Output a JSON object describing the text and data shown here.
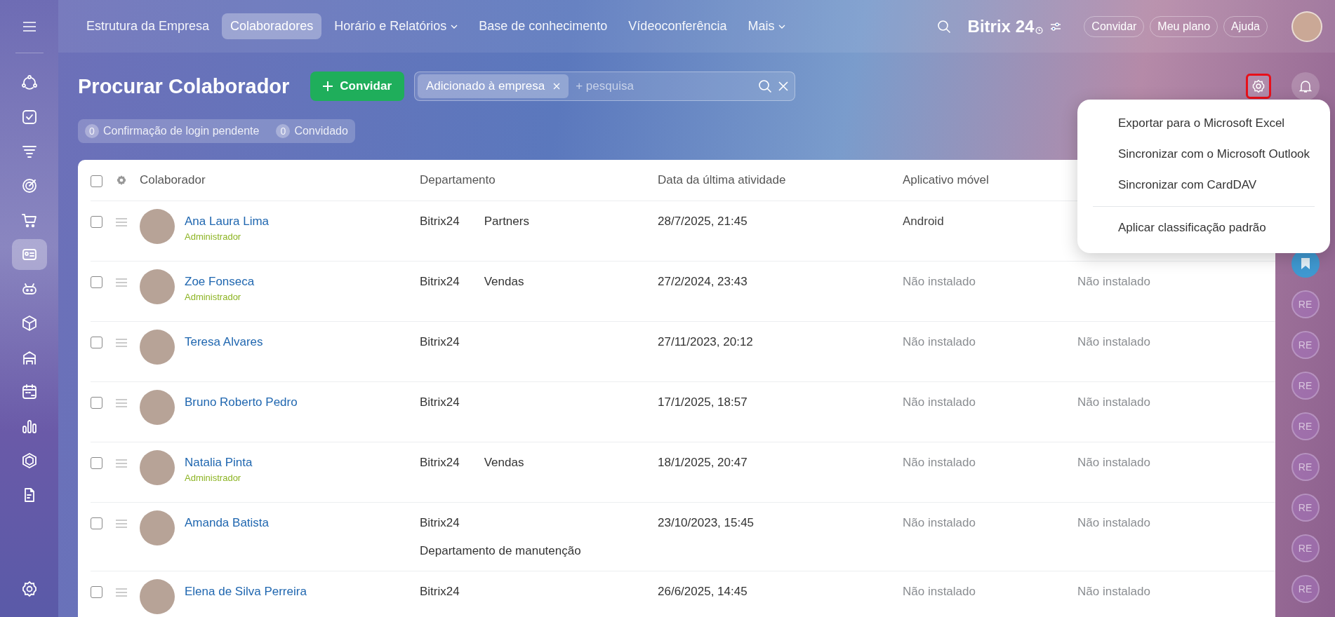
{
  "top_nav": {
    "items": [
      {
        "label": "Estrutura da Empresa",
        "selected": false,
        "dropdown": false
      },
      {
        "label": "Colaboradores",
        "selected": true,
        "dropdown": false
      },
      {
        "label": "Horário e Relatórios",
        "selected": false,
        "dropdown": true
      },
      {
        "label": "Base de conhecimento",
        "selected": false,
        "dropdown": false
      },
      {
        "label": "Vídeoconferência",
        "selected": false,
        "dropdown": false
      },
      {
        "label": "Mais",
        "selected": false,
        "dropdown": true
      }
    ],
    "logo": {
      "name": "Bitrix",
      "number": "24"
    },
    "buttons": [
      "Convidar",
      "Meu plano",
      "Ajuda"
    ]
  },
  "sidebar": {
    "items": [
      {
        "kind": "network",
        "selected": false
      },
      {
        "kind": "tasks",
        "selected": false
      },
      {
        "kind": "funnel",
        "selected": false
      },
      {
        "kind": "target",
        "selected": false
      },
      {
        "kind": "cart",
        "selected": false
      },
      {
        "kind": "contacts",
        "selected": true
      },
      {
        "kind": "robot",
        "selected": false
      },
      {
        "kind": "box",
        "selected": false
      },
      {
        "kind": "store",
        "selected": false
      },
      {
        "kind": "calendar",
        "selected": false
      },
      {
        "kind": "chart",
        "selected": false
      },
      {
        "kind": "hexagon",
        "selected": false
      },
      {
        "kind": "document",
        "selected": false
      }
    ]
  },
  "page": {
    "title": "Procurar Colaborador",
    "invite_button": "Convidar",
    "search": {
      "tag": "Adicionado à empresa",
      "placeholder": "+ pesquisa"
    },
    "settings_highlighted": true,
    "counters": [
      {
        "count": "0",
        "label": "Confirmação de login pendente"
      },
      {
        "count": "0",
        "label": "Convidado"
      }
    ]
  },
  "table": {
    "select_all": false,
    "columns": [
      "Colaborador",
      "Departamento",
      "Data da última atividade",
      "Aplicativo móvel"
    ],
    "rows": [
      {
        "name": "Ana Laura Lima",
        "role": "Administrador",
        "selected": false,
        "departments": [
          "Bitrix24",
          "Partners"
        ],
        "last_activity": "28/7/2025, 21:45",
        "mobile_app": "Android",
        "app_installed": true
      },
      {
        "name": "Zoe Fonseca",
        "role": "Administrador",
        "selected": false,
        "departments": [
          "Bitrix24",
          "Vendas"
        ],
        "last_activity": "27/2/2024, 23:43",
        "mobile_app": "Não instalado",
        "app_installed": false,
        "column_5": "Não instalado"
      },
      {
        "name": "Teresa Alvares",
        "selected": false,
        "departments": [
          "Bitrix24"
        ],
        "last_activity": "27/11/2023, 20:12",
        "mobile_app": "Não instalado",
        "app_installed": false,
        "column_5": "Não instalado"
      },
      {
        "name": "Bruno Roberto Pedro",
        "selected": false,
        "departments": [
          "Bitrix24"
        ],
        "last_activity": "17/1/2025, 18:57",
        "mobile_app": "Não instalado",
        "app_installed": false,
        "column_5": "Não instalado"
      },
      {
        "name": "Natalia Pinta",
        "role": "Administrador",
        "selected": false,
        "departments": [
          "Bitrix24",
          "Vendas"
        ],
        "last_activity": "18/1/2025, 20:47",
        "mobile_app": "Não instalado",
        "app_installed": false,
        "column_5": "Não instalado"
      },
      {
        "name": "Amanda Batista",
        "selected": false,
        "departments": [
          "Bitrix24",
          "Departamento de manutenção"
        ],
        "last_activity": "23/10/2023, 15:45",
        "mobile_app": "Não instalado",
        "app_installed": false,
        "column_5": "Não instalado"
      },
      {
        "name": "Elena de Silva Perreira",
        "selected": false,
        "departments": [
          "Bitrix24"
        ],
        "last_activity": "26/6/2025, 14:45",
        "mobile_app": "Não instalado",
        "app_installed": false,
        "column_5": "Não instalado"
      }
    ]
  },
  "settings_menu": {
    "items": [
      {
        "label": "Exportar para o Microsoft Excel",
        "separator_before": false
      },
      {
        "label": "Sincronizar com o Microsoft Outlook",
        "separator_before": false
      },
      {
        "label": "Sincronizar com CardDAV",
        "separator_before": false
      },
      {
        "label": "Aplicar classificação padrão",
        "separator_before": true
      }
    ]
  },
  "right_rail": {
    "contacts": [
      "RE",
      "RE",
      "RE",
      "RE",
      "RE",
      "RE",
      "RE",
      "RE"
    ]
  }
}
